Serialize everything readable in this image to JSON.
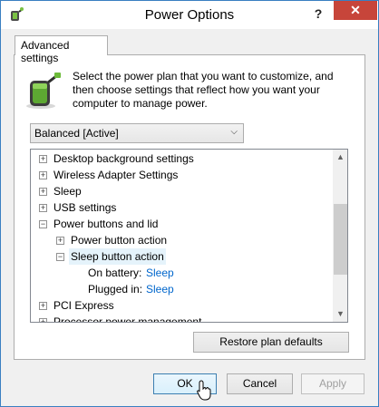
{
  "window": {
    "title": "Power Options",
    "help_label": "?",
    "close_label": "✕"
  },
  "tab": {
    "label": "Advanced settings"
  },
  "description": "Select the power plan that you want to customize, and then choose settings that reflect how you want your computer to manage power.",
  "plan_select": {
    "value": "Balanced [Active]"
  },
  "tree": {
    "items": [
      {
        "label": "Desktop background settings",
        "level": 0,
        "expander": "plus"
      },
      {
        "label": "Wireless Adapter Settings",
        "level": 0,
        "expander": "plus"
      },
      {
        "label": "Sleep",
        "level": 0,
        "expander": "plus"
      },
      {
        "label": "USB settings",
        "level": 0,
        "expander": "plus"
      },
      {
        "label": "Power buttons and lid",
        "level": 0,
        "expander": "minus"
      },
      {
        "label": "Power button action",
        "level": 1,
        "expander": "plus"
      },
      {
        "label": "Sleep button action",
        "level": 1,
        "expander": "minus",
        "selected": true
      },
      {
        "label": "On battery:",
        "value": "Sleep",
        "level": 2
      },
      {
        "label": "Plugged in:",
        "value": "Sleep",
        "level": 2
      },
      {
        "label": "PCI Express",
        "level": 0,
        "expander": "plus"
      },
      {
        "label": "Processor power management",
        "level": 0,
        "expander": "plus"
      }
    ]
  },
  "buttons": {
    "restore": "Restore plan defaults",
    "ok": "OK",
    "cancel": "Cancel",
    "apply": "Apply"
  },
  "colors": {
    "close_button": "#c7453a",
    "link": "#0066cc",
    "selection": "#e5f3fb"
  }
}
